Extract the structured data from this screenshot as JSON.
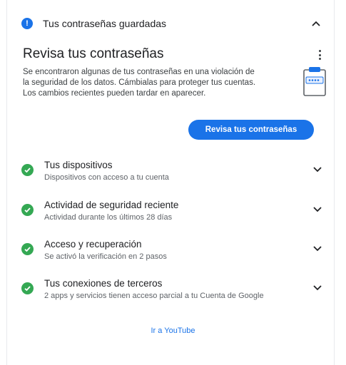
{
  "header": {
    "title": "Tus contraseñas guardadas",
    "info_icon": "info-icon",
    "collapse_icon": "chevron-up-icon"
  },
  "main": {
    "title": "Revisa tus contraseñas",
    "description_lines": [
      "Se encontraron algunas de tus contraseñas en una violación de",
      "la seguridad de los datos. Cámbialas para proteger tus cuentas.",
      "Los cambios recientes pueden tardar en aparecer."
    ],
    "review_button": "Revisa tus contraseñas",
    "more_icon": "more-vert-icon",
    "illustration_icon": "clipboard-password-icon"
  },
  "items": [
    {
      "title": "Tus dispositivos",
      "subtitle": "Dispositivos con acceso a tu cuenta"
    },
    {
      "title": "Actividad de seguridad reciente",
      "subtitle": "Actividad durante los últimos 28 días"
    },
    {
      "title": "Acceso y recuperación",
      "subtitle": "Se activó la verificación en 2 pasos"
    },
    {
      "title": "Tus conexiones de terceros",
      "subtitle": "2 apps y servicios tienen acceso parcial a tu Cuenta de Google"
    }
  ],
  "footer": {
    "link": "Ir a YouTube"
  },
  "colors": {
    "accent": "#1a73e8",
    "success": "#34a853"
  }
}
